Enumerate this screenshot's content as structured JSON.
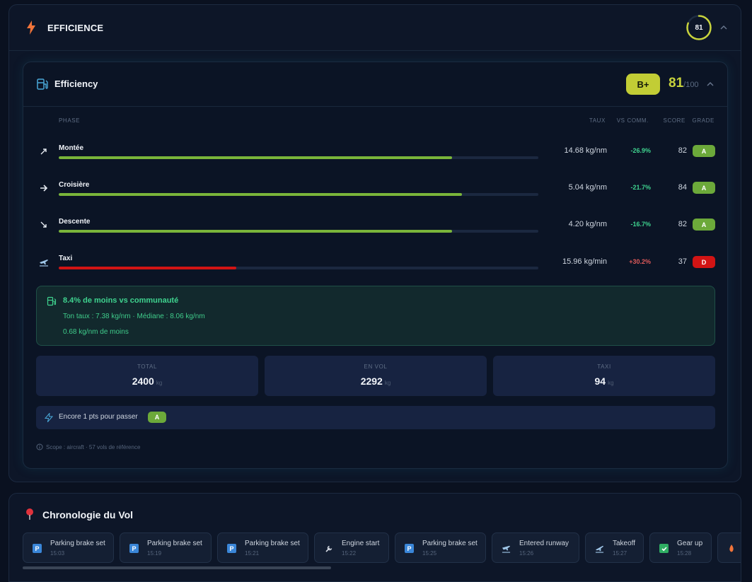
{
  "section": {
    "title": "EFFICIENCE",
    "score": "81",
    "score_fraction": 0.81
  },
  "card": {
    "title": "Efficiency",
    "grade": "B+",
    "score": "81",
    "score_max": "/100",
    "columns": {
      "phase": "PHASE",
      "rate": "TAUX",
      "vs": "VS COMM.",
      "score": "SCORE",
      "grade": "GRADE"
    },
    "rows": [
      {
        "icon": "climb-arrow-icon",
        "label": "Montée",
        "rate": "14.68 kg/nm",
        "vs": "-26.9%",
        "score": "82",
        "grade": "A",
        "progress": 0.82,
        "color": "#7ab53a"
      },
      {
        "icon": "right-arrow-icon",
        "label": "Croisière",
        "rate": "5.04 kg/nm",
        "vs": "-21.7%",
        "score": "84",
        "grade": "A",
        "progress": 0.84,
        "color": "#7ab53a"
      },
      {
        "icon": "descent-arrow-icon",
        "label": "Descente",
        "rate": "4.20 kg/nm",
        "vs": "-16.7%",
        "score": "82",
        "grade": "A",
        "progress": 0.82,
        "color": "#7ab53a"
      },
      {
        "icon": "taxi-plane-icon",
        "label": "Taxi",
        "rate": "15.96 kg/min",
        "vs": "+30.2%",
        "score": "37",
        "grade": "D",
        "progress": 0.37,
        "color": "#d21414"
      }
    ],
    "note": {
      "title": "8.4% de moins vs communauté",
      "line1": "Ton taux : 7.38 kg/nm · Médiane : 8.06 kg/nm",
      "line2": "0.68 kg/nm de moins"
    },
    "stats": [
      {
        "label": "TOTAL",
        "value": "2400",
        "unit": "kg"
      },
      {
        "label": "EN VOL",
        "value": "2292",
        "unit": "kg"
      },
      {
        "label": "TAXI",
        "value": "94",
        "unit": "kg"
      }
    ],
    "hint": {
      "text": "Encore 1 pts pour passer",
      "badge": "A"
    },
    "scope": "Scope : aircraft · 57 vols de référence"
  },
  "timeline": {
    "title": "Chronologie du Vol",
    "events": [
      {
        "icon": "parking-icon",
        "name": "Parking brake set",
        "time": "15:03"
      },
      {
        "icon": "parking-icon",
        "name": "Parking brake set",
        "time": "15:19"
      },
      {
        "icon": "parking-icon",
        "name": "Parking brake set",
        "time": "15:21"
      },
      {
        "icon": "wrench-icon",
        "name": "Engine start",
        "time": "15:22"
      },
      {
        "icon": "parking-icon",
        "name": "Parking brake set",
        "time": "15:25"
      },
      {
        "icon": "runway-plane-icon",
        "name": "Entered runway",
        "time": "15:26"
      },
      {
        "icon": "takeoff-icon",
        "name": "Takeoff",
        "time": "15:27"
      },
      {
        "icon": "check-icon",
        "name": "Gear up",
        "time": "15:28"
      }
    ]
  },
  "colors": {
    "accent": "#c2cd35",
    "good": "#3fd38f",
    "bad": "#e05a5a",
    "grade_a": "#6ca93a",
    "grade_d": "#d21414"
  }
}
